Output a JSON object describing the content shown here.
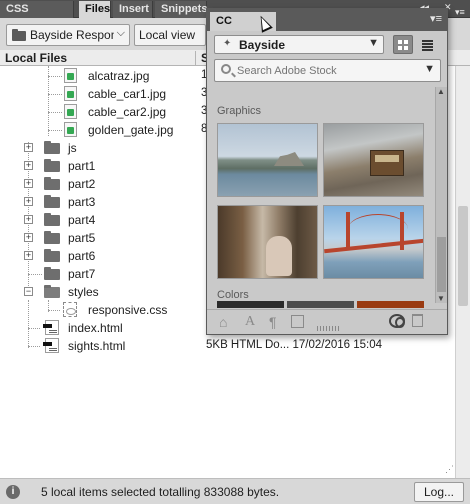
{
  "tabs": [
    {
      "label": "CSS Designer",
      "active": false
    },
    {
      "label": "Files",
      "active": true
    },
    {
      "label": "Insert",
      "active": false
    },
    {
      "label": "Snippets",
      "active": false
    }
  ],
  "top_controls": {
    "collapse": "◂◂",
    "close": "✕",
    "menu": "▾≡"
  },
  "files_toolbar": {
    "site_select": "Bayside Respons",
    "view_select": "Local view"
  },
  "columns": {
    "name": "Local Files",
    "size": "Si"
  },
  "files": [
    {
      "name": "alcatraz.jpg",
      "size_partial": "1",
      "type": "jpg"
    },
    {
      "name": "cable_car1.jpg",
      "size_partial": "3",
      "type": "jpg"
    },
    {
      "name": "cable_car2.jpg",
      "size_partial": "3",
      "type": "jpg"
    },
    {
      "name": "golden_gate.jpg",
      "size_partial": "8",
      "type": "jpg"
    },
    {
      "name": "js",
      "type": "folder"
    },
    {
      "name": "part1",
      "type": "folder"
    },
    {
      "name": "part2",
      "type": "folder"
    },
    {
      "name": "part3",
      "type": "folder"
    },
    {
      "name": "part4",
      "type": "folder"
    },
    {
      "name": "part5",
      "type": "folder"
    },
    {
      "name": "part6",
      "type": "folder"
    },
    {
      "name": "part7",
      "type": "folder"
    },
    {
      "name": "styles",
      "type": "folder"
    },
    {
      "name": "responsive.css",
      "type": "css"
    },
    {
      "name": "index.html",
      "type": "html"
    },
    {
      "name": "sights.html",
      "type": "html",
      "meta": "5KB HTML Do...  17/02/2016 15:04"
    }
  ],
  "status": {
    "message": "5 local items selected totalling 833088 bytes.",
    "log_button": "Log..."
  },
  "cc_libraries": {
    "tab_label": "CC Libraries",
    "library_select": "Bayside",
    "search_placeholder": "Search Adobe Stock",
    "graphics_label": "Graphics",
    "colors_label": "Colors",
    "color_swatches": [
      "#2b2b2b",
      "#4d4d4d",
      "#9a3b12"
    ],
    "graphics": [
      "alcatraz",
      "cable-car-street",
      "cable-car-interior",
      "golden-gate"
    ]
  }
}
